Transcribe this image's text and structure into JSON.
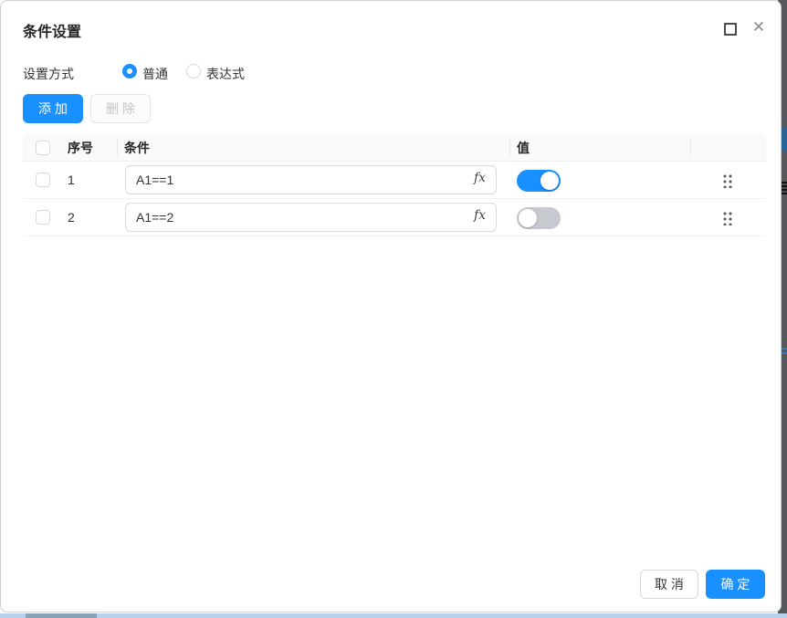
{
  "dialog": {
    "title": "条件设置",
    "window_controls": {
      "close_glyph": "✕"
    },
    "mode": {
      "label": "设置方式",
      "options": [
        {
          "label": "普通",
          "selected": true
        },
        {
          "label": "表达式",
          "selected": false
        }
      ]
    },
    "toolbar": {
      "add_label": "添 加",
      "delete_label": "删 除",
      "delete_disabled": true
    },
    "table": {
      "headers": {
        "index": "序号",
        "condition": "条件",
        "value": "值"
      },
      "fx_label": "fx",
      "rows": [
        {
          "index": "1",
          "condition": "A1==1",
          "value_on": true
        },
        {
          "index": "2",
          "condition": "A1==2",
          "value_on": false
        }
      ]
    },
    "footer": {
      "cancel_label": "取 消",
      "ok_label": "确 定"
    },
    "colors": {
      "primary_blue": "#1890ff",
      "toggle_off_gray": "#c6cad0",
      "header_bg": "#fafafa",
      "disabled_text": "#c4c4c4"
    }
  }
}
